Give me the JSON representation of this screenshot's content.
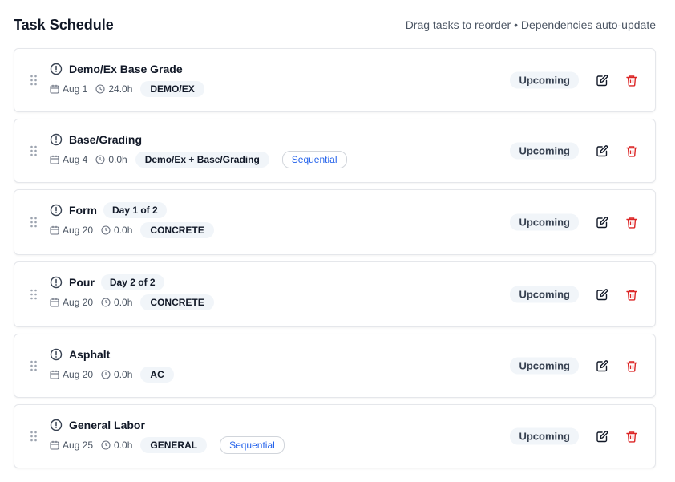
{
  "header": {
    "title": "Task Schedule",
    "hint": "Drag tasks to reorder • Dependencies auto-update"
  },
  "tasks": [
    {
      "name": "Demo/Ex Base Grade",
      "day_badge": "",
      "date": "Aug 1",
      "hours": "24.0h",
      "tag": "DEMO/EX",
      "sequential": "",
      "status": "Upcoming"
    },
    {
      "name": "Base/Grading",
      "day_badge": "",
      "date": "Aug 4",
      "hours": "0.0h",
      "tag": "Demo/Ex + Base/Grading",
      "sequential": "Sequential",
      "status": "Upcoming"
    },
    {
      "name": "Form",
      "day_badge": "Day 1 of 2",
      "date": "Aug 20",
      "hours": "0.0h",
      "tag": "CONCRETE",
      "sequential": "",
      "status": "Upcoming"
    },
    {
      "name": "Pour",
      "day_badge": "Day 2 of 2",
      "date": "Aug 20",
      "hours": "0.0h",
      "tag": "CONCRETE",
      "sequential": "",
      "status": "Upcoming"
    },
    {
      "name": "Asphalt",
      "day_badge": "",
      "date": "Aug 20",
      "hours": "0.0h",
      "tag": "AC",
      "sequential": "",
      "status": "Upcoming"
    },
    {
      "name": "General Labor",
      "day_badge": "",
      "date": "Aug 25",
      "hours": "0.0h",
      "tag": "GENERAL",
      "sequential": "Sequential",
      "status": "Upcoming"
    }
  ],
  "colors": {
    "accent_blue": "#2563eb",
    "danger_red": "#dc2626",
    "badge_bg": "#f1f5f9",
    "border": "#e5e7eb"
  },
  "icons": {
    "grip": "grip-vertical-icon",
    "alert": "alert-circle-icon",
    "calendar": "calendar-icon",
    "clock": "clock-icon",
    "edit": "edit-icon",
    "delete": "trash-icon"
  }
}
